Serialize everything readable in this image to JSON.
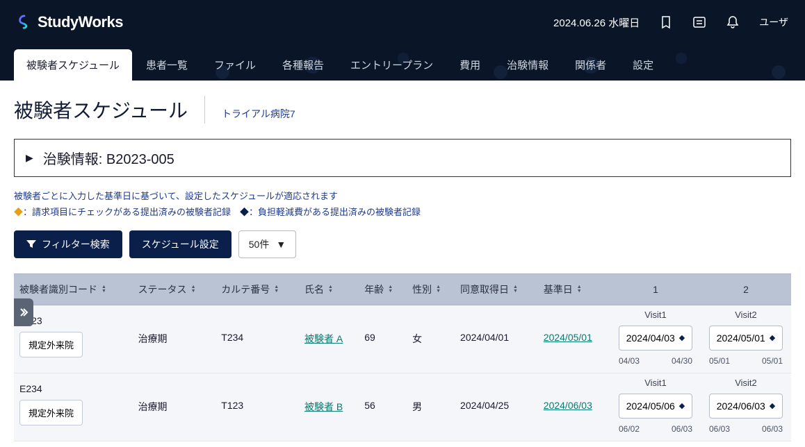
{
  "header": {
    "app_name": "StudyWorks",
    "date_text": "2024.06.26 水曜日",
    "user_label": "ユーザ"
  },
  "tabs": [
    "被験者スケジュール",
    "患者一覧",
    "ファイル",
    "各種報告",
    "エントリープラン",
    "費用",
    "治験情報",
    "関係者",
    "設定"
  ],
  "active_tab_index": 0,
  "page_title": "被験者スケジュール",
  "hospital_name": "トライアル病院7",
  "info_banner": "治験情報: B2023-005",
  "note_line1": "被験者ごとに入力した基準日に基づいて、設定したスケジュールが適応されます",
  "note_line2a": "：請求項目にチェックがある提出済みの被験者記録　",
  "note_line2b": "：負担軽減費がある提出済みの被験者記録",
  "toolbar": {
    "filter_label": "フィルター検索",
    "schedule_label": "スケジュール設定",
    "page_size": "50件"
  },
  "columns": [
    "被験者識別コード",
    "ステータス",
    "カルテ番号",
    "氏名",
    "年齢",
    "性別",
    "同意取得日",
    "基準日",
    "1",
    "2"
  ],
  "unscheduled_btn": "規定外来院",
  "rows": [
    {
      "code": "E123",
      "status": "治療期",
      "karte": "T234",
      "name": "被験者 A",
      "age": "69",
      "sex": "女",
      "consent": "2024/04/01",
      "refdate": "2024/05/01",
      "visits": [
        {
          "name": "Visit1",
          "date": "2024/04/03",
          "from": "04/03",
          "to": "04/30"
        },
        {
          "name": "Visit2",
          "date": "2024/05/01",
          "from": "05/01",
          "to": "05/01"
        }
      ]
    },
    {
      "code": "E234",
      "status": "治療期",
      "karte": "T123",
      "name": "被験者 B",
      "age": "56",
      "sex": "男",
      "consent": "2024/04/25",
      "refdate": "2024/06/03",
      "visits": [
        {
          "name": "Visit1",
          "date": "2024/05/06",
          "from": "06/02",
          "to": "06/03"
        },
        {
          "name": "Visit2",
          "date": "2024/06/03",
          "from": "06/03",
          "to": "06/03"
        }
      ]
    }
  ]
}
